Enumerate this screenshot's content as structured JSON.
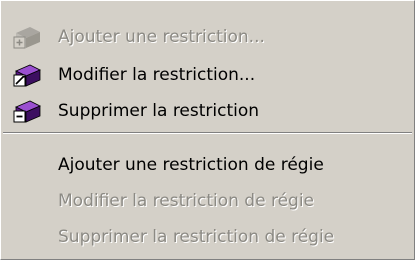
{
  "menu": {
    "items": [
      {
        "label": "Ajouter une restriction...",
        "icon": "add-restriction-icon",
        "enabled": false
      },
      {
        "label": "Modifier la restriction...",
        "icon": "edit-restriction-icon",
        "enabled": true
      },
      {
        "label": "Supprimer la restriction",
        "icon": "delete-restriction-icon",
        "enabled": true
      },
      {
        "label": "Ajouter une restriction de régie",
        "enabled": true
      },
      {
        "label": "Modifier la restriction de régie",
        "enabled": false
      },
      {
        "label": "Supprimer la restriction de régie",
        "enabled": false
      }
    ]
  },
  "colors": {
    "menu_bg": "#d4d0c8",
    "disabled_text": "#8c8a84",
    "icon_purple": "#6a1fa0"
  }
}
